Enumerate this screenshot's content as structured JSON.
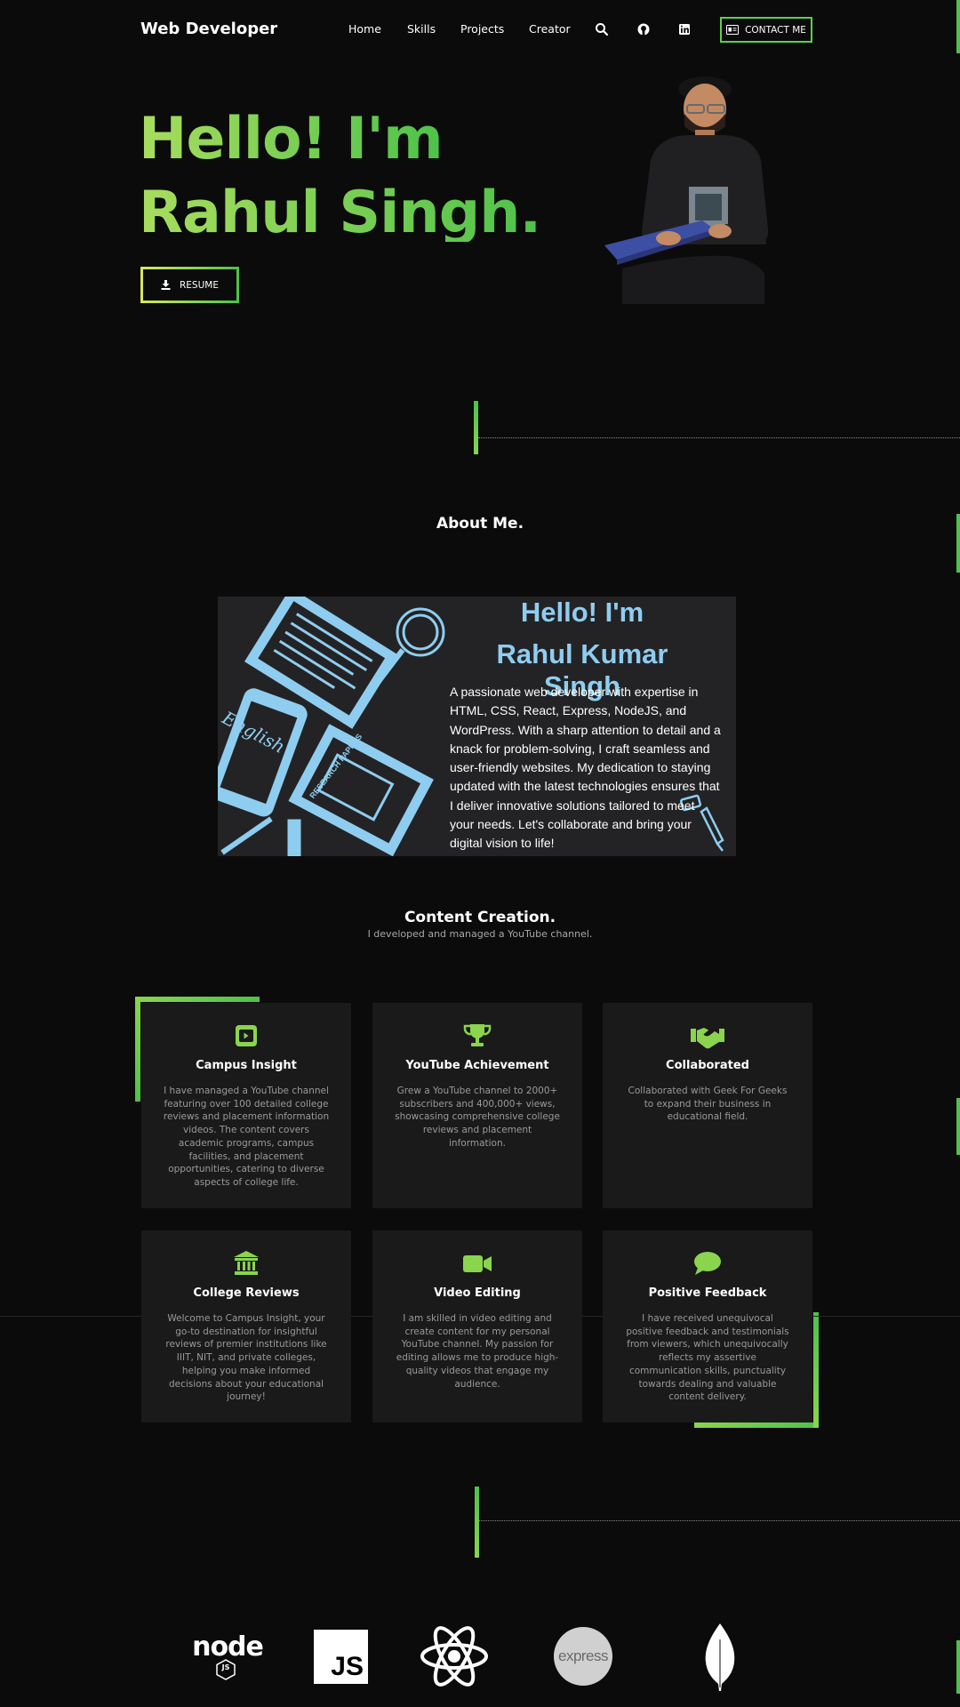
{
  "nav": {
    "brand": "Web Developer",
    "links": [
      "Home",
      "Skills",
      "Projects",
      "Creator"
    ],
    "contact_label": "CONTACT ME",
    "icons": [
      "search-icon",
      "github-icon",
      "linkedin-icon",
      "contact-card-icon"
    ]
  },
  "hero": {
    "line1": "Hello! I'm",
    "line2": "Rahul Singh.",
    "resume_label": "RESUME",
    "colors": {
      "gradient_start": "#a8dd5e",
      "gradient_end": "#4ec24a"
    }
  },
  "about": {
    "title": "About Me.",
    "card_line1": "Hello! I'm",
    "card_line2": "Rahul Kumar Singh",
    "card_text": "A passionate web developer with expertise in HTML, CSS, React, Express, NodeJS, and WordPress. With a sharp attention to detail and a knack for problem-solving, I craft seamless and user-friendly websites. My dedication to staying updated with the latest technologies ensures that I deliver innovative solutions tailored to meet your needs. Let's collaborate and bring your digital vision to life!",
    "illustration_labels": [
      "English",
      "RESEARCH PAPERS"
    ]
  },
  "content": {
    "title": "Content Creation.",
    "subtitle": "I developed and managed a YouTube channel.",
    "cards": [
      {
        "icon": "youtube-icon",
        "title": "Campus Insight",
        "text": "I have managed a YouTube channel featuring over 100 detailed college reviews and placement information videos. The content covers academic programs, campus facilities, and placement opportunities, catering to diverse aspects of college life."
      },
      {
        "icon": "trophy-icon",
        "title": "YouTube Achievement",
        "text": "Grew a YouTube channel to 2000+ subscribers and 400,000+ views, showcasing comprehensive college reviews and placement information."
      },
      {
        "icon": "handshake-icon",
        "title": "Collaborated",
        "text": "Collaborated with Geek For Geeks to expand their business in educational field."
      },
      {
        "icon": "building-columns-icon",
        "title": "College Reviews",
        "text": "Welcome to Campus Insight, your go-to destination for insightful reviews of premier institutions like IIIT, NIT, and private colleges, helping you make informed decisions about your educational journey!"
      },
      {
        "icon": "video-camera-icon",
        "title": "Video Editing",
        "text": "I am skilled in video editing and create content for my personal YouTube channel. My passion for editing allows me to produce high-quality videos that engage my audience."
      },
      {
        "icon": "chat-bubble-icon",
        "title": "Positive Feedback",
        "text": "I have received unequivocal positive feedback and testimonials from viewers, which unequivocally reflects my assertive communication skills, punctuality towards dealing and valuable content delivery."
      }
    ]
  },
  "tech": {
    "logos": [
      {
        "name": "nodejs-logo",
        "text": "node",
        "badge": "JS"
      },
      {
        "name": "javascript-logo",
        "text": "JS"
      },
      {
        "name": "react-logo"
      },
      {
        "name": "express-logo",
        "text": "express"
      },
      {
        "name": "mongodb-logo"
      }
    ]
  },
  "colors": {
    "accent": "#4ec24a",
    "background": "#0b0b0b",
    "card": "#1a1a1a",
    "about_card": "#232325",
    "about_text_accent": "#8fcdf0"
  }
}
